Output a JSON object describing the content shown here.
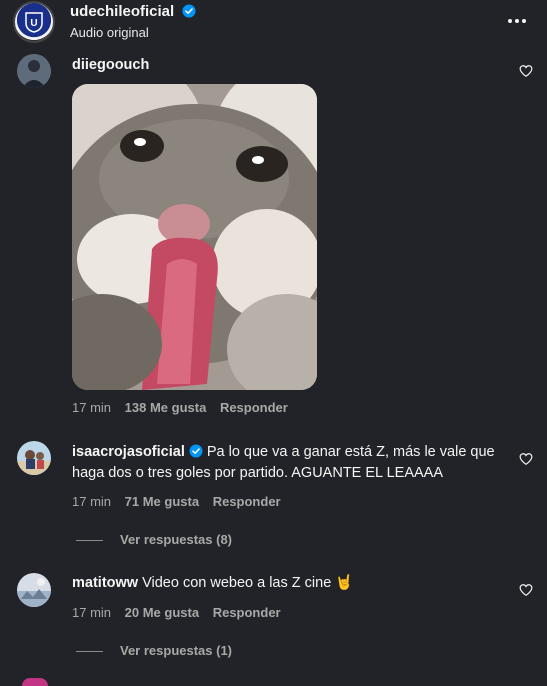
{
  "header": {
    "username": "udechileoficial",
    "subtitle": "Audio original"
  },
  "comments": [
    {
      "username": "diiegoouch",
      "time": "17 min",
      "likes": "138 Me gusta",
      "reply": "Responder"
    },
    {
      "username": "isaacrojasoficial",
      "text": "Pa lo que va a ganar está Z, más le vale que haga dos o tres goles por partido. AGUANTE EL LEAAAA",
      "time": "17 min",
      "likes": "71 Me gusta",
      "reply": "Responder",
      "view_replies": "Ver respuestas (8)"
    },
    {
      "username": "matitoww",
      "text": "Video con webeo a las Z cine 🤘",
      "time": "17 min",
      "likes": "20 Me gusta",
      "reply": "Responder",
      "view_replies": "Ver respuestas (1)"
    }
  ],
  "colors": {
    "background": "#212328",
    "verified": "#0095f6",
    "text_primary": "#f5f5f5",
    "text_secondary": "#a8a8a8"
  },
  "icons": {
    "more": "more-horizontal-icon",
    "heart": "heart-outline-icon",
    "verified": "verified-badge-icon"
  }
}
